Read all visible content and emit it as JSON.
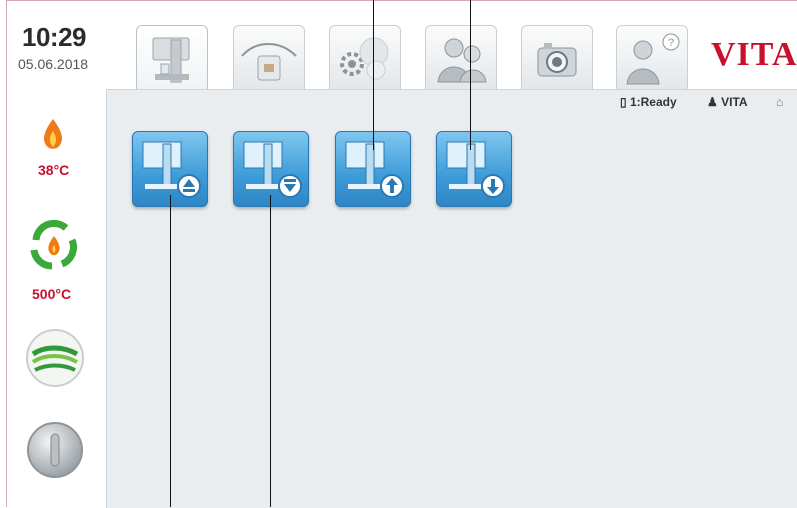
{
  "header": {
    "time": "10:29",
    "date": "05.06.2018",
    "logo": "VITA"
  },
  "tabs": [
    {
      "icon": "firing-chamber-icon",
      "active": true
    },
    {
      "icon": "program-curve-icon",
      "active": false
    },
    {
      "icon": "settings-gears-icon",
      "active": false
    },
    {
      "icon": "users-icon",
      "active": false
    },
    {
      "icon": "camera-icon",
      "active": false
    },
    {
      "icon": "help-icon",
      "active": false
    }
  ],
  "sidebar": {
    "chamber_temp": "38°C",
    "standby_temp": "500°C"
  },
  "status": {
    "program": "1:Ready",
    "user": "VITA"
  },
  "program_buttons": [
    {
      "icon": "lift-up-icon"
    },
    {
      "icon": "lift-down-icon"
    },
    {
      "icon": "lift-up-step-icon"
    },
    {
      "icon": "lift-down-step-icon"
    }
  ],
  "colors": {
    "accent_red": "#c8102e",
    "button_blue": "#3d9bd8",
    "panel_bg": "#e9edf0"
  }
}
